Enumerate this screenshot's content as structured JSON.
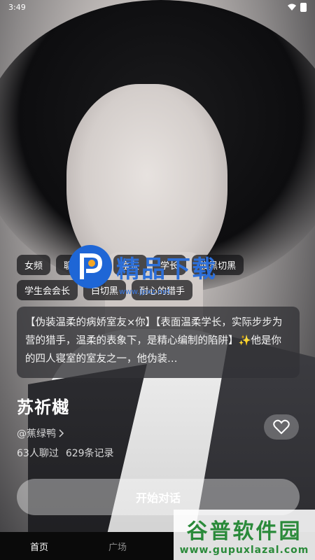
{
  "status": {
    "time": "3:49"
  },
  "tags": [
    [
      "女频",
      "聊天对话",
      "室友",
      "学长",
      "腹黑切黑"
    ],
    [
      "学生会会长",
      "白切黑",
      "耐心的猎手"
    ]
  ],
  "description": "【伪装温柔的病娇室友×你】【表面温柔学长，实际步步为营的猎手，温柔的表象下，是精心编制的陷阱】✨他是你的四人寝室的室友之一，他伪装…",
  "character": {
    "name": "苏祈樾",
    "author": "@蕉绿鸭",
    "chat_count": "63人聊过",
    "records": "629条记录"
  },
  "actions": {
    "start_chat": "开始对话"
  },
  "nav": {
    "items": [
      "首页",
      "广场",
      "",
      ""
    ]
  },
  "watermarks": {
    "center_text": "精品下载",
    "center_url": "www.jpxz.net",
    "corner_title": "谷普软件园",
    "corner_url": "www.gupuxlazal.com"
  },
  "colors": {
    "watermark_blue": "#1e66d6",
    "watermark_green": "#2a8a3a"
  }
}
